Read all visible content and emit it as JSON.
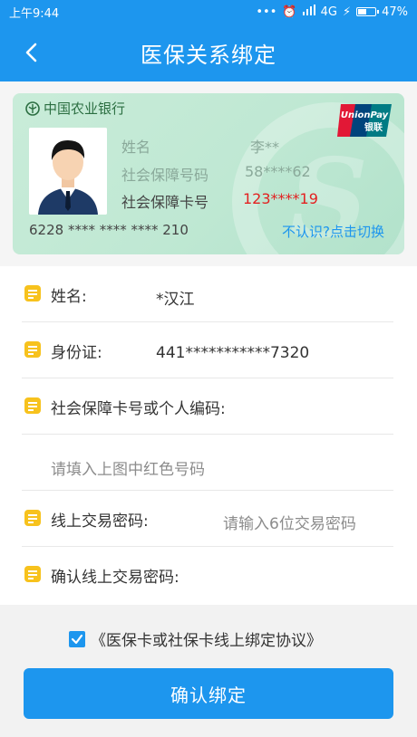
{
  "status_bar": {
    "time": "上午9:44",
    "network": "4G",
    "battery": "47%",
    "battery_level": 0.47
  },
  "header": {
    "title": "医保关系绑定",
    "back_icon": "chevron-left-icon"
  },
  "card": {
    "bank_name": "中国农业银行",
    "unionpay_text": "UnionPay",
    "unionpay_cn": "银联",
    "rows": [
      {
        "label": "姓名",
        "value": "李**"
      },
      {
        "label": "社会保障号码",
        "value": "58****62"
      },
      {
        "label": "社会保障卡号",
        "value": "123****19"
      }
    ],
    "card_number": "6228 **** **** **** 210",
    "switch_link": "不认识?点击切换"
  },
  "form": {
    "name_label": "姓名:",
    "name_value": "*汉江",
    "id_label": "身份证:",
    "id_value": "441***********7320",
    "card_code_label": "社会保障卡号或个人编码:",
    "card_code_placeholder": "请填入上图中红色号码",
    "password_label": "线上交易密码:",
    "password_placeholder": "请输入6位交易密码",
    "confirm_password_label": "确认线上交易密码:"
  },
  "agreement": {
    "checked": true,
    "text": "《医保卡或社保卡线上绑定协议》"
  },
  "confirm_button": "确认绑定",
  "colors": {
    "primary": "#1d96ee",
    "highlight_red": "#e32020",
    "note_icon": "#f7c21d"
  }
}
